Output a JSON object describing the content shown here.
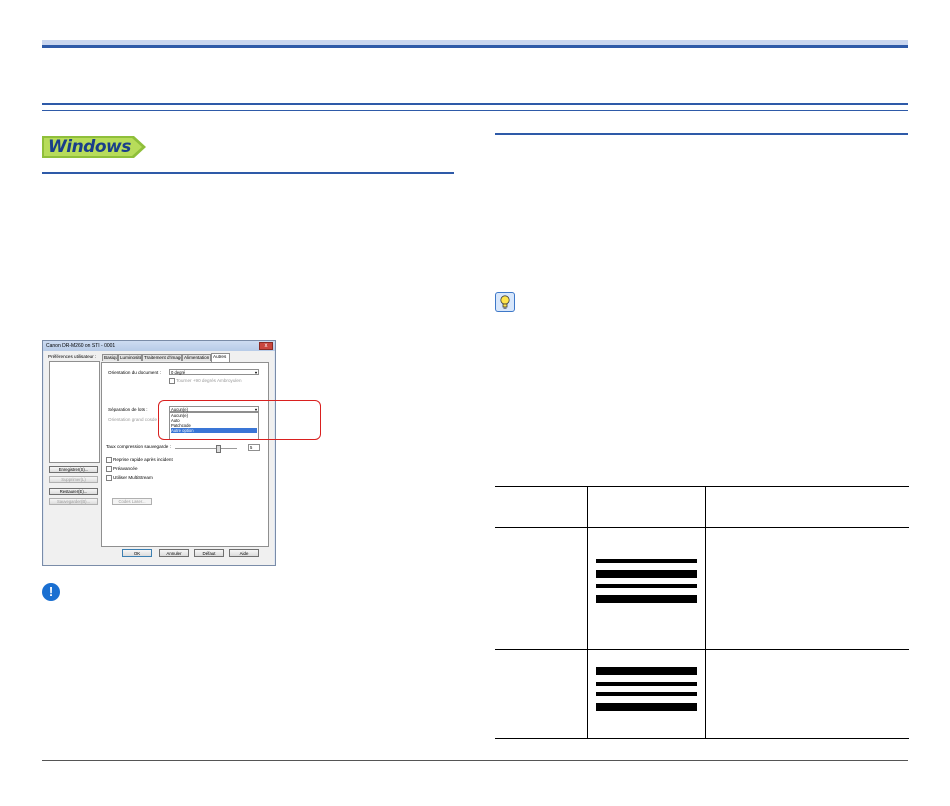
{
  "badge": {
    "text": "Windows"
  },
  "dialog": {
    "title": "Canon DR-M260 on STI - 0001",
    "close_glyph": "x",
    "preferences_label": "Préférences utilisateur :",
    "buttons": {
      "save": "Enregistrer(S)...",
      "delete": "Supprimer(L)",
      "restore": "Restaurer(E)...",
      "backup": "Sauvegarder(B)..."
    },
    "tabs": [
      "Basique",
      "Luminosité",
      "Traitement d'image",
      "Alimentation",
      "Autres"
    ],
    "panel": {
      "orientation_label": "Orientation du document :",
      "orientation_value": "0 degré",
      "rotate_checkbox": "Tourner +90 degrés Ambroyulen",
      "separation_label": "Séparation de lots :",
      "separation_value": "Aucun(e)",
      "separation_options": [
        "Aucun(e)",
        "Auto",
        "Patchcode",
        "Autre option"
      ],
      "rotation_label": "Orientation grand cosde :",
      "compression_label": "Taux compression sauvegarde :",
      "compression_value": "5",
      "checkbox_rapid": "Reprise rapide après incident",
      "checkbox_prefeed": "Préavancée",
      "checkbox_multistream": "Utiliser MultiStream",
      "codes_button": "Codes Laser...",
      "arrow_glyph": "▾"
    },
    "footer_buttons": [
      "OK",
      "Annuler",
      "Défaut",
      "Aide"
    ]
  },
  "icons": {
    "caution": "caution-icon",
    "caution_glyph": "!",
    "hint": "lightbulb-hint-icon"
  },
  "colors": {
    "accent_blue": "#2e5aa8",
    "badge_green": "#8fbf3a",
    "highlight_red": "#d9201f"
  }
}
